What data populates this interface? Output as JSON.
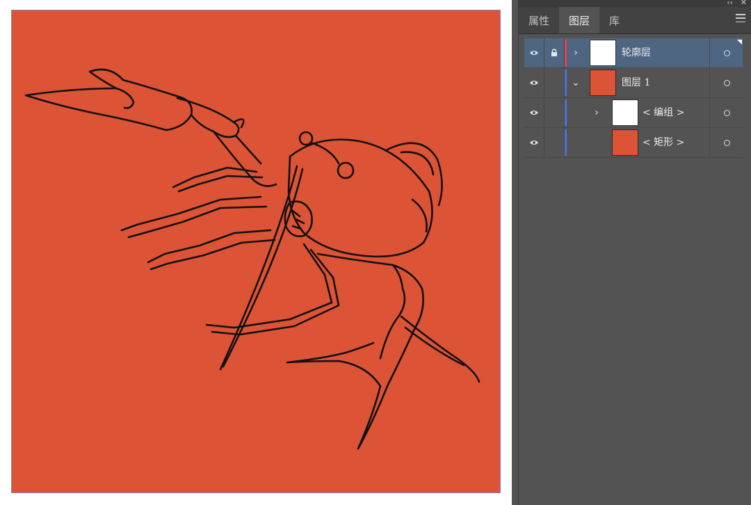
{
  "window": {
    "collapse_glyph": "‹‹",
    "close_glyph": "✕"
  },
  "panel": {
    "tabs": [
      {
        "label": "属性",
        "active": false
      },
      {
        "label": "图层",
        "active": true
      },
      {
        "label": "库",
        "active": false
      }
    ],
    "menu_icon": "hamburger-menu-icon"
  },
  "layers": [
    {
      "name": "轮廓层",
      "visible": true,
      "locked": true,
      "expanded": false,
      "selected": true,
      "color": "#e0454e",
      "thumbnail": "white"
    },
    {
      "name": "图层 1",
      "visible": true,
      "locked": false,
      "expanded": true,
      "selected": false,
      "color": "#4a72e0",
      "thumbnail": "red"
    },
    {
      "name": "< 编组 >",
      "visible": true,
      "locked": false,
      "expanded": false,
      "selected": false,
      "color": "#4a72e0",
      "thumbnail": "white"
    },
    {
      "name": "< 矩形 >",
      "visible": true,
      "locked": false,
      "expanded": null,
      "selected": false,
      "color": "#4a72e0",
      "thumbnail": "red"
    }
  ],
  "colors": {
    "artboard_fill": "#dc5335",
    "panel_bg": "#535353",
    "selected_row": "#4f6683"
  }
}
